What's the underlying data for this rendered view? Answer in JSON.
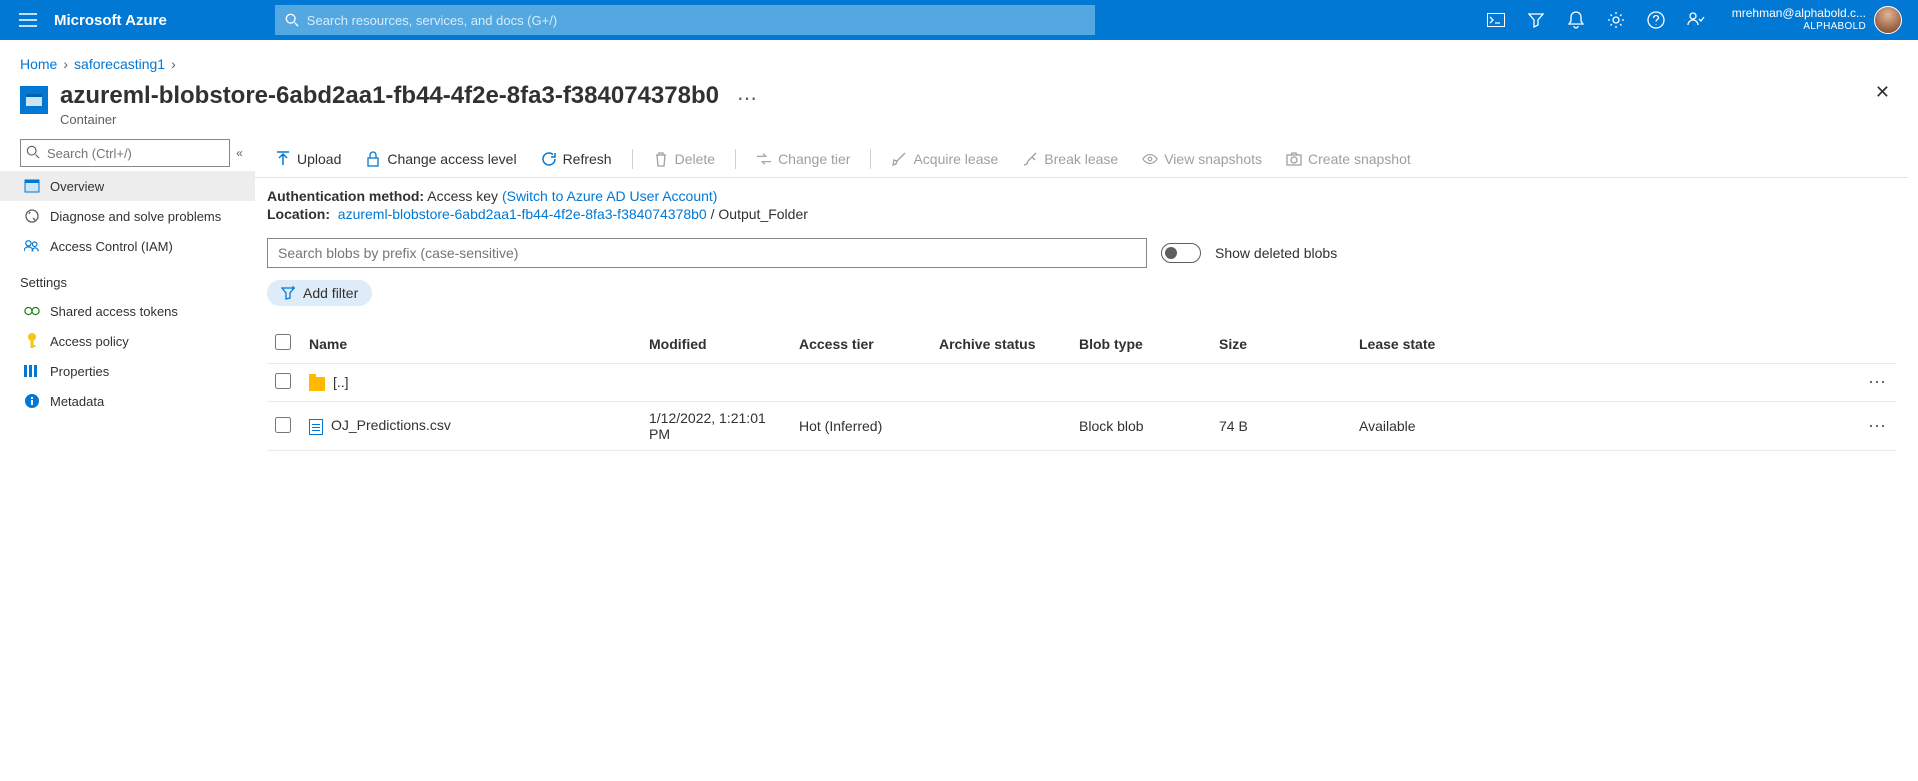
{
  "header": {
    "brand": "Microsoft Azure",
    "search_placeholder": "Search resources, services, and docs (G+/)",
    "user_email": "mrehman@alphabold.c...",
    "user_tenant": "ALPHABOLD"
  },
  "breadcrumb": {
    "home": "Home",
    "parent": "saforecasting1"
  },
  "title": {
    "name": "azureml-blobstore-6abd2aa1-fb44-4f2e-8fa3-f384074378b0",
    "subtitle": "Container"
  },
  "sidebar": {
    "search_placeholder": "Search (Ctrl+/)",
    "overview": "Overview",
    "diagnose": "Diagnose and solve problems",
    "iam": "Access Control (IAM)",
    "section_settings": "Settings",
    "sas": "Shared access tokens",
    "access_policy": "Access policy",
    "properties": "Properties",
    "metadata": "Metadata"
  },
  "toolbar": {
    "upload": "Upload",
    "change_access": "Change access level",
    "refresh": "Refresh",
    "delete": "Delete",
    "change_tier": "Change tier",
    "acquire_lease": "Acquire lease",
    "break_lease": "Break lease",
    "view_snapshots": "View snapshots",
    "create_snapshot": "Create snapshot"
  },
  "info": {
    "auth_label": "Authentication method:",
    "auth_value": "Access key",
    "auth_switch": "(Switch to Azure AD User Account)",
    "loc_label": "Location:",
    "loc_link": "azureml-blobstore-6abd2aa1-fb44-4f2e-8fa3-f384074378b0",
    "loc_tail": "Output_Folder"
  },
  "filter": {
    "search_placeholder": "Search blobs by prefix (case-sensitive)",
    "show_deleted": "Show deleted blobs",
    "add_filter": "Add filter"
  },
  "table": {
    "headers": {
      "name": "Name",
      "modified": "Modified",
      "access_tier": "Access tier",
      "archive_status": "Archive status",
      "blob_type": "Blob type",
      "size": "Size",
      "lease_state": "Lease state"
    },
    "rows": [
      {
        "kind": "folder",
        "name": "[..]",
        "modified": "",
        "access_tier": "",
        "archive_status": "",
        "blob_type": "",
        "size": "",
        "lease_state": ""
      },
      {
        "kind": "file",
        "name": "OJ_Predictions.csv",
        "modified": "1/12/2022, 1:21:01 PM",
        "access_tier": "Hot (Inferred)",
        "archive_status": "",
        "blob_type": "Block blob",
        "size": "74 B",
        "lease_state": "Available"
      }
    ]
  }
}
